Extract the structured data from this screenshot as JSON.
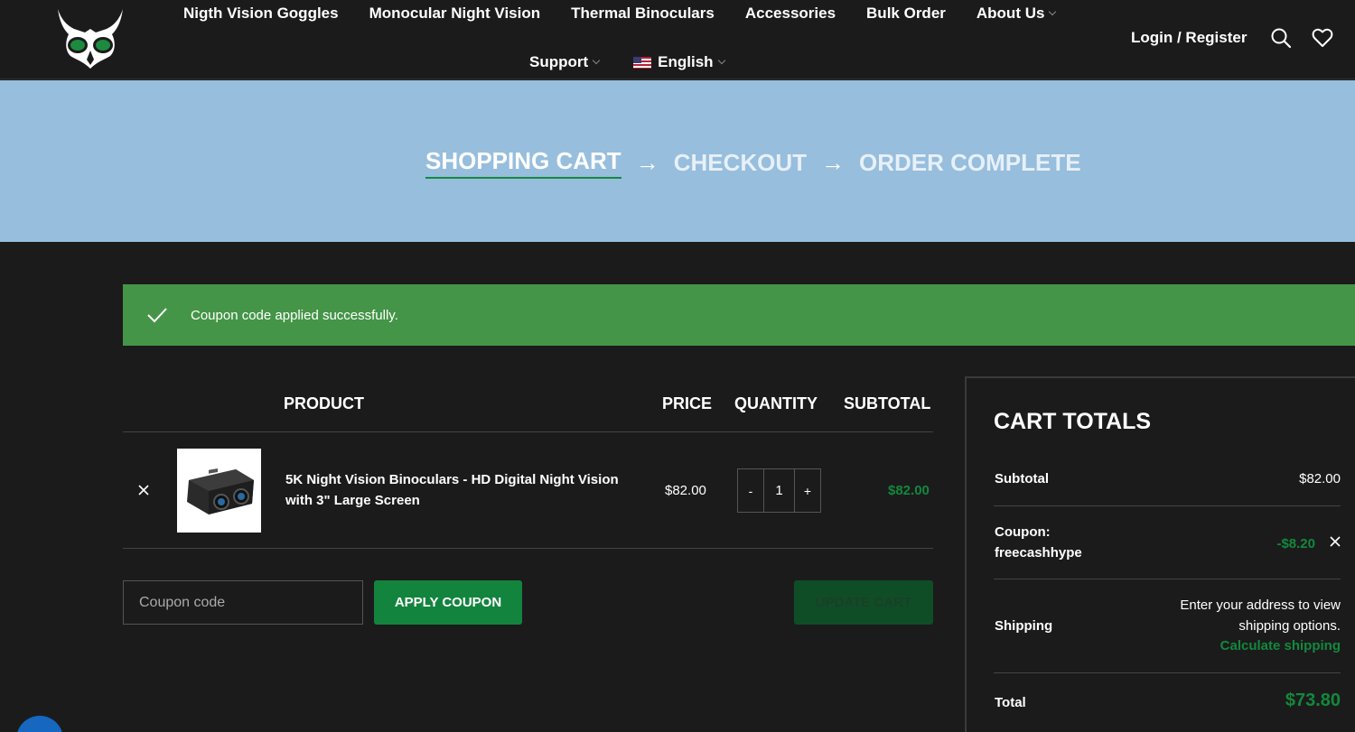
{
  "header": {
    "nav_row1": [
      {
        "label": "Nigth Vision Goggles",
        "caret": false
      },
      {
        "label": "Monocular Night Vision",
        "caret": false
      },
      {
        "label": "Thermal Binoculars",
        "caret": false
      },
      {
        "label": "Accessories",
        "caret": false
      },
      {
        "label": "Bulk Order",
        "caret": false
      },
      {
        "label": "About Us",
        "caret": true
      }
    ],
    "support_label": "Support",
    "language_label": "English",
    "login_label": "Login / Register",
    "icons": [
      "search-icon",
      "heart-icon"
    ]
  },
  "steps": {
    "cart": "SHOPPING CART",
    "checkout": "CHECKOUT",
    "complete": "ORDER COMPLETE",
    "arrow": "→"
  },
  "notice": {
    "message": "Coupon code applied successfully."
  },
  "cart_table": {
    "headers": {
      "product": "PRODUCT",
      "price": "PRICE",
      "quantity": "QUANTITY",
      "subtotal": "SUBTOTAL"
    },
    "item": {
      "name": "5K Night Vision Binoculars - HD Digital Night Vision with 3\" Large Screen",
      "price": "$82.00",
      "quantity": "1",
      "qty_minus": "-",
      "qty_plus": "+",
      "subtotal": "$82.00"
    }
  },
  "coupon": {
    "placeholder": "Coupon code",
    "apply_label": "APPLY COUPON",
    "update_label": "UPDATE CART"
  },
  "totals": {
    "title": "CART TOTALS",
    "subtotal_label": "Subtotal",
    "subtotal_value": "$82.00",
    "coupon_label": "Coupon:",
    "coupon_code": "freecashhype",
    "coupon_value": "-$8.20",
    "shipping_label": "Shipping",
    "shipping_line1": "Enter your address to view",
    "shipping_line2": "shipping options.",
    "calc_shipping": "Calculate shipping",
    "total_label": "Total",
    "total_value": "$73.80"
  },
  "colors": {
    "background": "#1c1b1c",
    "band": "#97bedd",
    "accent_green": "#12883c",
    "notice_green": "#449547"
  }
}
